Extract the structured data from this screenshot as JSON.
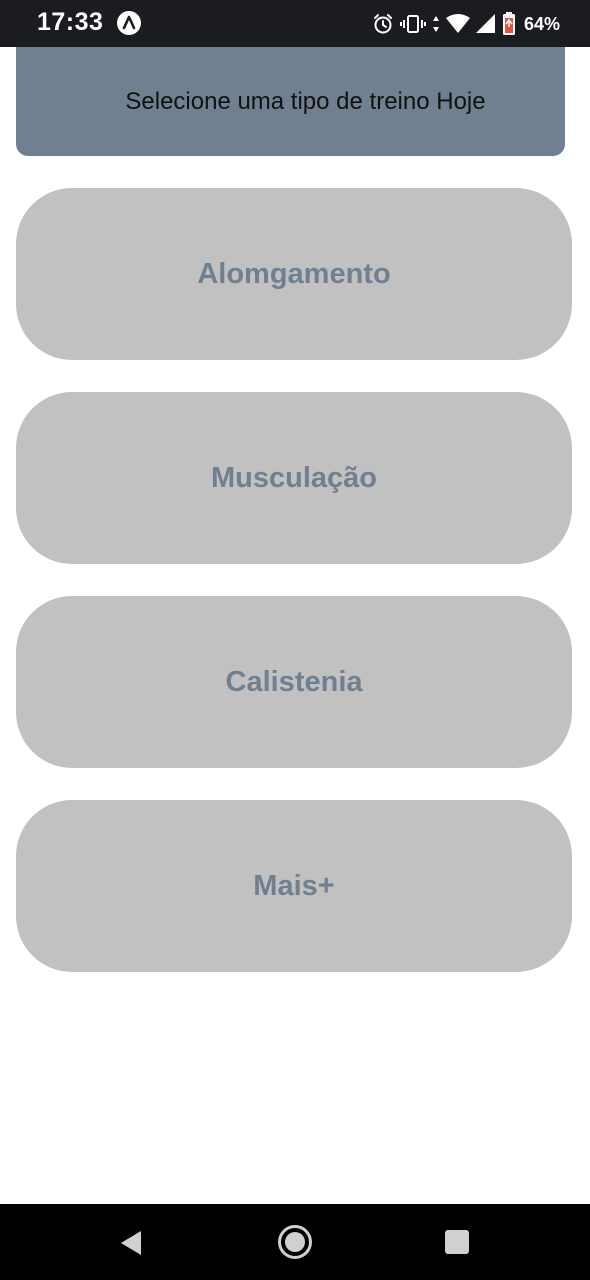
{
  "status_bar": {
    "time": "17:33",
    "battery_percent": "64%",
    "icons": [
      "app-notification-icon",
      "alarm-icon",
      "vibrate-icon",
      "data-arrows-icon",
      "wifi-icon",
      "cell-signal-icon",
      "battery-icon"
    ]
  },
  "header": {
    "text": "Selecione uma tipo de treino Hoje"
  },
  "workouts": [
    {
      "label": "Alomgamento"
    },
    {
      "label": "Musculação"
    },
    {
      "label": "Calistenia"
    },
    {
      "label": "Mais+"
    }
  ],
  "nav_bar": {
    "icons": [
      "back-icon",
      "home-icon",
      "recents-icon"
    ]
  },
  "colors": {
    "header_bg": "#708090",
    "button_bg": "#c1c1c1",
    "button_text": "#708090",
    "status_bar_bg": "#1b1c1f",
    "nav_bar_bg": "#000000"
  }
}
